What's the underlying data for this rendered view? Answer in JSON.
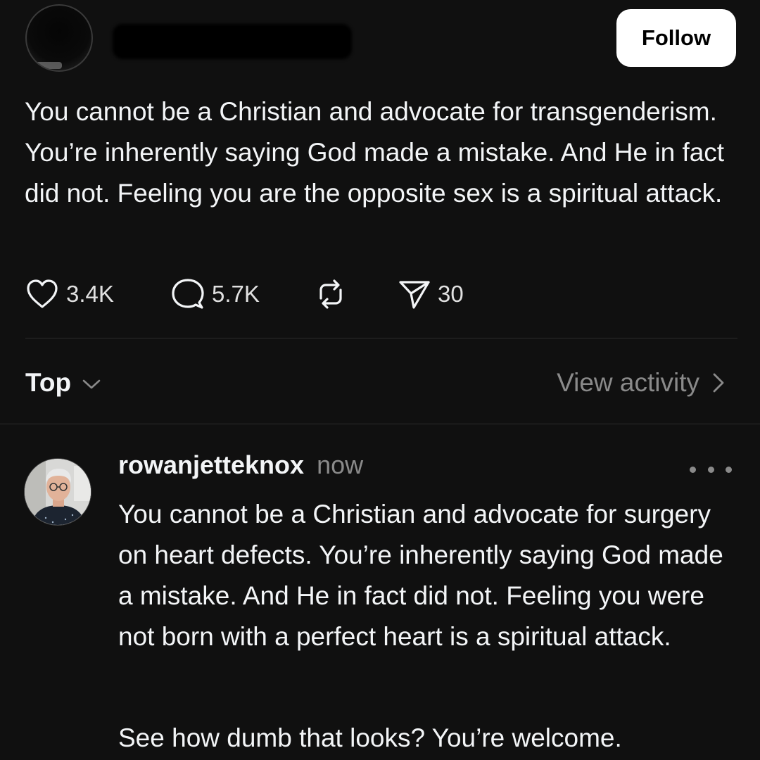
{
  "post": {
    "author_name": "",
    "follow_label": "Follow",
    "text": "You cannot be a Christian and advocate for transgenderism. You’re inherently saying God made a mistake. And He in fact did not. Feeling you are the opposite sex is a spiritual attack.",
    "actions": {
      "likes": "3.4K",
      "replies": "5.7K",
      "shares": "30"
    },
    "icons": {
      "like": "heart-icon",
      "reply": "comment-bubble-icon",
      "repost": "repost-icon",
      "share": "send-icon"
    }
  },
  "replies_bar": {
    "sort_label": "Top",
    "view_activity_label": "View activity"
  },
  "reply": {
    "username": "rowanjetteknox",
    "time": "now",
    "text_1": "You cannot be a Christian and advocate for surgery on heart defects. You’re inherently saying God made a mistake. And He in fact did not. Feeling you were not born with a perfect heart is a spiritual attack.",
    "text_2": "See how dumb that looks? You’re welcome."
  },
  "colors": {
    "background": "#101010",
    "text_primary": "#f3f5f7",
    "text_secondary": "#8a8a8a",
    "divider": "#2c2c2c",
    "follow_button_bg": "#ffffff"
  }
}
